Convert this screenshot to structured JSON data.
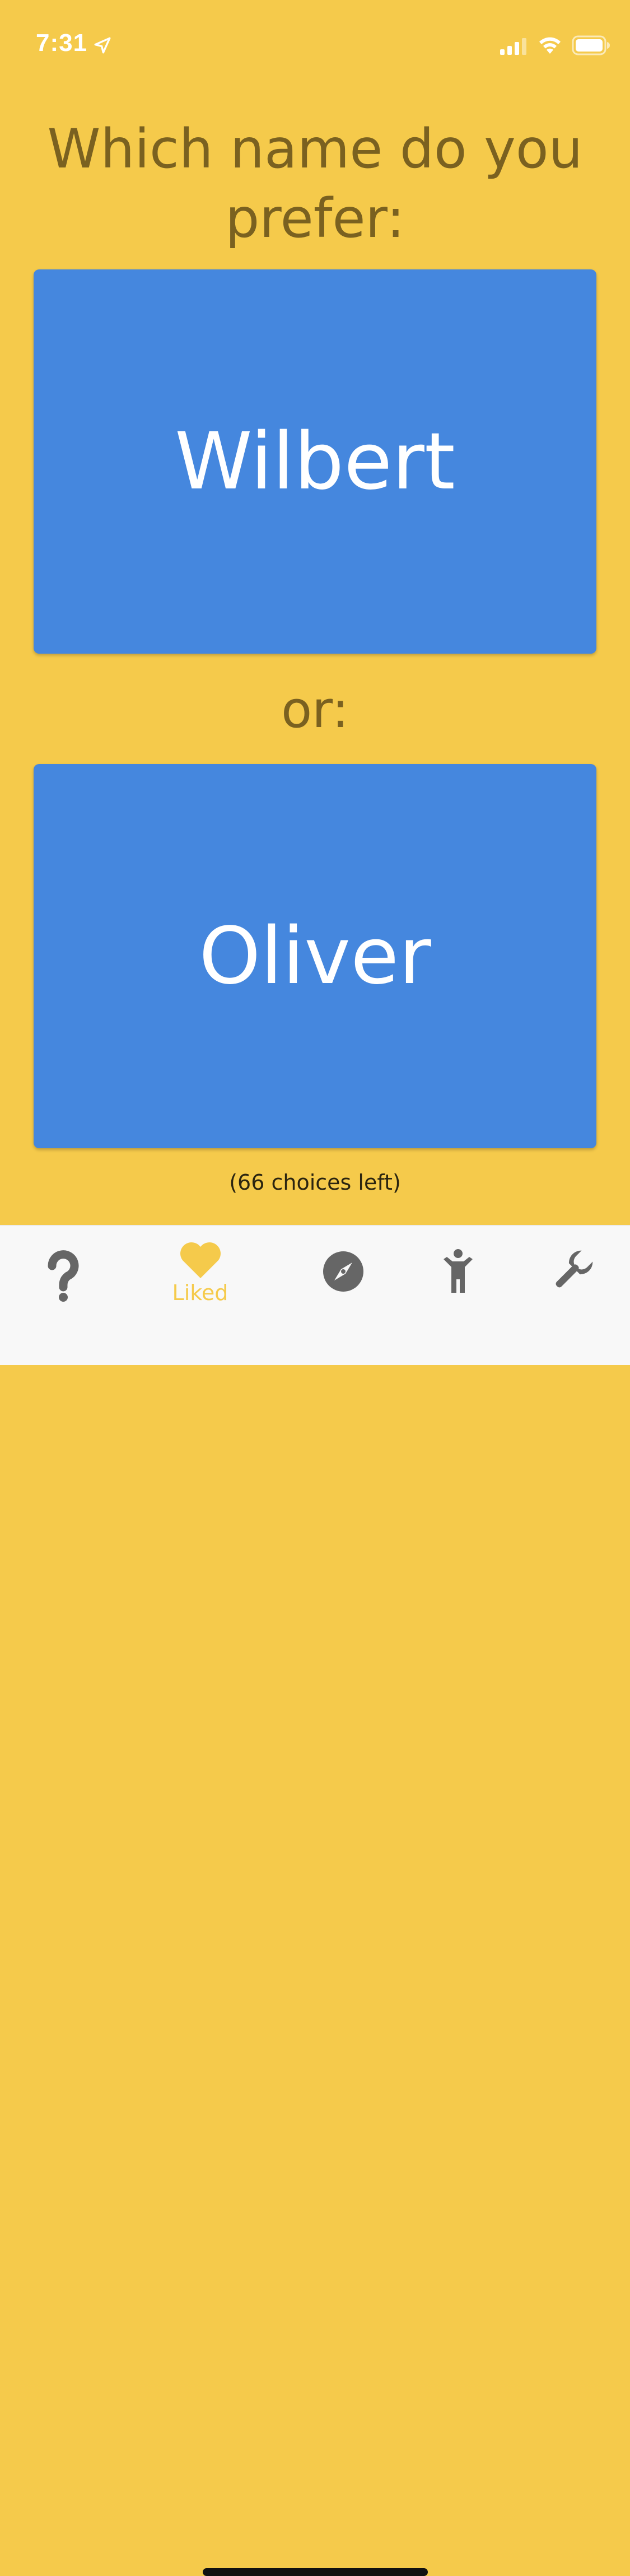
{
  "status_bar": {
    "time": "7:31",
    "icons": [
      "location-arrow-icon",
      "cellular-signal-icon",
      "wifi-icon",
      "battery-icon"
    ]
  },
  "prompt": "Which name do you prefer:",
  "options": {
    "first": "Wilbert",
    "separator": "or:",
    "second": "Oliver"
  },
  "choices_left": "(66 choices left)",
  "tab_bar": {
    "tabs": [
      {
        "icon": "question-mark-icon",
        "label": "",
        "active": false
      },
      {
        "icon": "heart-icon",
        "label": "Liked",
        "active": true
      },
      {
        "icon": "compass-icon",
        "label": "",
        "active": false
      },
      {
        "icon": "child-icon",
        "label": "",
        "active": false
      },
      {
        "icon": "wrench-icon",
        "label": "",
        "active": false
      }
    ]
  },
  "colors": {
    "background": "#F5CA4B",
    "card": "#4587DE",
    "text_dark": "#7A6120",
    "tab_active": "#F5CA4B",
    "tab_inactive": "#666666"
  }
}
